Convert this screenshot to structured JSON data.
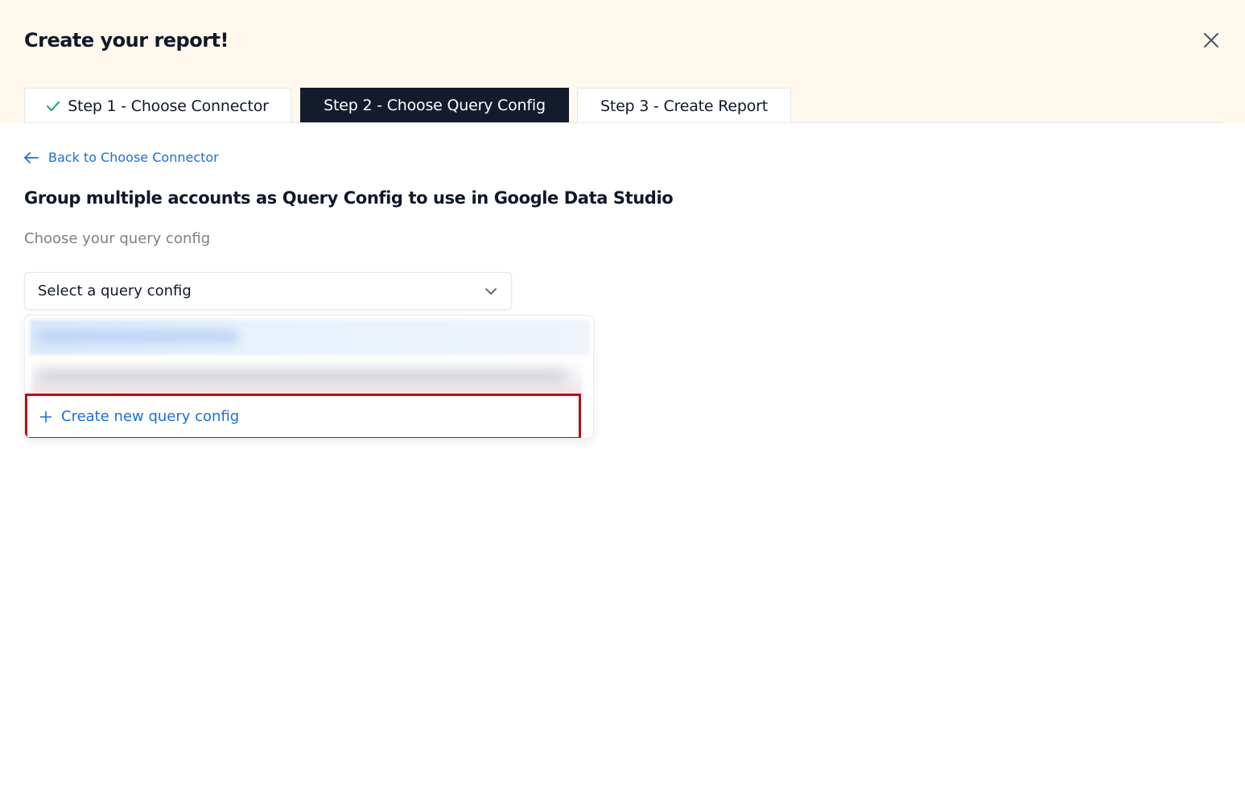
{
  "dialog": {
    "title": "Create your report!",
    "close_icon": "close-icon"
  },
  "tabs": [
    {
      "label": "Step 1 -  Choose Connector",
      "state": "completed",
      "icon": "check-icon"
    },
    {
      "label": "Step 2 -  Choose Query Config",
      "state": "active"
    },
    {
      "label": "Step 3 -  Create Report",
      "state": "pending"
    }
  ],
  "back_link": {
    "label": "Back to Choose Connector",
    "icon": "arrow-left-icon"
  },
  "heading": "Group multiple accounts as Query Config to use in Google Data Studio",
  "query_config": {
    "label": "Choose your query config",
    "selected": "Select a query config",
    "dropdown_icon": "chevron-down-icon",
    "create_option": {
      "label": "Create new query config",
      "icon": "plus-icon"
    }
  },
  "colors": {
    "header_bg": "#fff8ec",
    "active_tab_bg": "#141b2d",
    "link": "#1a6fd6",
    "check": "#12a36c",
    "highlight_border": "#b30f14"
  }
}
